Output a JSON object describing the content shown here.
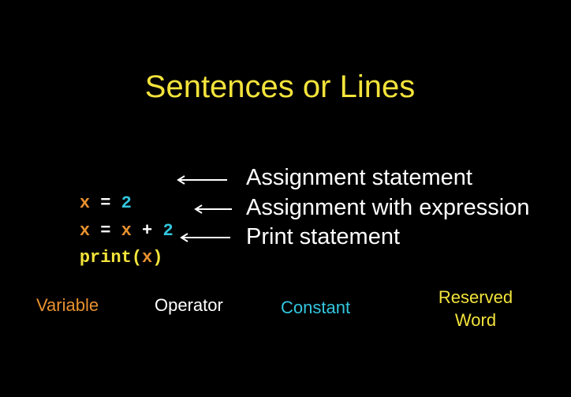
{
  "title": "Sentences or Lines",
  "lines": [
    {
      "tokens": [
        {
          "text": "x",
          "kind": "variable"
        },
        {
          "text": " = ",
          "kind": "operator"
        },
        {
          "text": "2",
          "kind": "constant"
        }
      ],
      "description": "Assignment statement"
    },
    {
      "tokens": [
        {
          "text": "x",
          "kind": "variable"
        },
        {
          "text": " = ",
          "kind": "operator"
        },
        {
          "text": "x",
          "kind": "variable"
        },
        {
          "text": " + ",
          "kind": "operator"
        },
        {
          "text": "2",
          "kind": "constant"
        }
      ],
      "description": "Assignment with expression"
    },
    {
      "tokens": [
        {
          "text": "print",
          "kind": "reserved"
        },
        {
          "text": "(",
          "kind": "reserved"
        },
        {
          "text": "x",
          "kind": "variable"
        },
        {
          "text": ")",
          "kind": "reserved"
        }
      ],
      "description": "Print statement"
    }
  ],
  "legend": {
    "variable": "Variable",
    "operator": "Operator",
    "constant": "Constant",
    "reserved_line1": "Reserved",
    "reserved_line2": "Word"
  },
  "colors": {
    "background": "#000000",
    "title": "#f3e33b",
    "variable": "#e8912f",
    "operator": "#ffffff",
    "constant": "#33c6df",
    "reserved": "#f3e33b",
    "description": "#ffffff"
  },
  "icons": {
    "arrow": "left-arrow-icon"
  }
}
